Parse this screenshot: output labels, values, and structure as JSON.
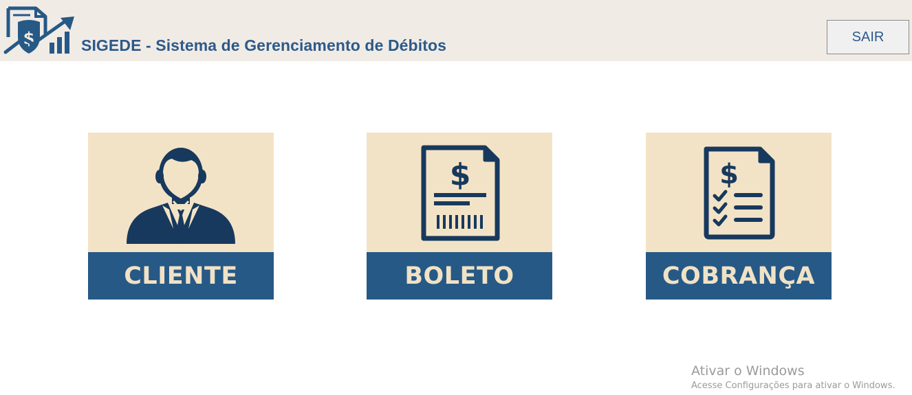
{
  "header": {
    "title": "SIGEDE - Sistema de Gerenciamento de Débitos",
    "logo_icon": "finance-shield-dollar-chart-icon",
    "exit_label": "SAIR"
  },
  "tiles": [
    {
      "label": "CLIENTE",
      "icon": "client-person-icon"
    },
    {
      "label": "BOLETO",
      "icon": "boleto-invoice-icon"
    },
    {
      "label": "COBRANÇA",
      "icon": "billing-checklist-icon"
    }
  ],
  "watermark": {
    "title": "Ativar o Windows",
    "subtitle": "Acesse Configurações para ativar o Windows."
  },
  "colors": {
    "header_bg": "#f1ebe6",
    "brand_blue": "#265986",
    "title_blue": "#2c5a8a",
    "tile_bg": "#f3e3c6",
    "tile_text": "#f1e2c5",
    "icon_navy": "#17395e"
  }
}
